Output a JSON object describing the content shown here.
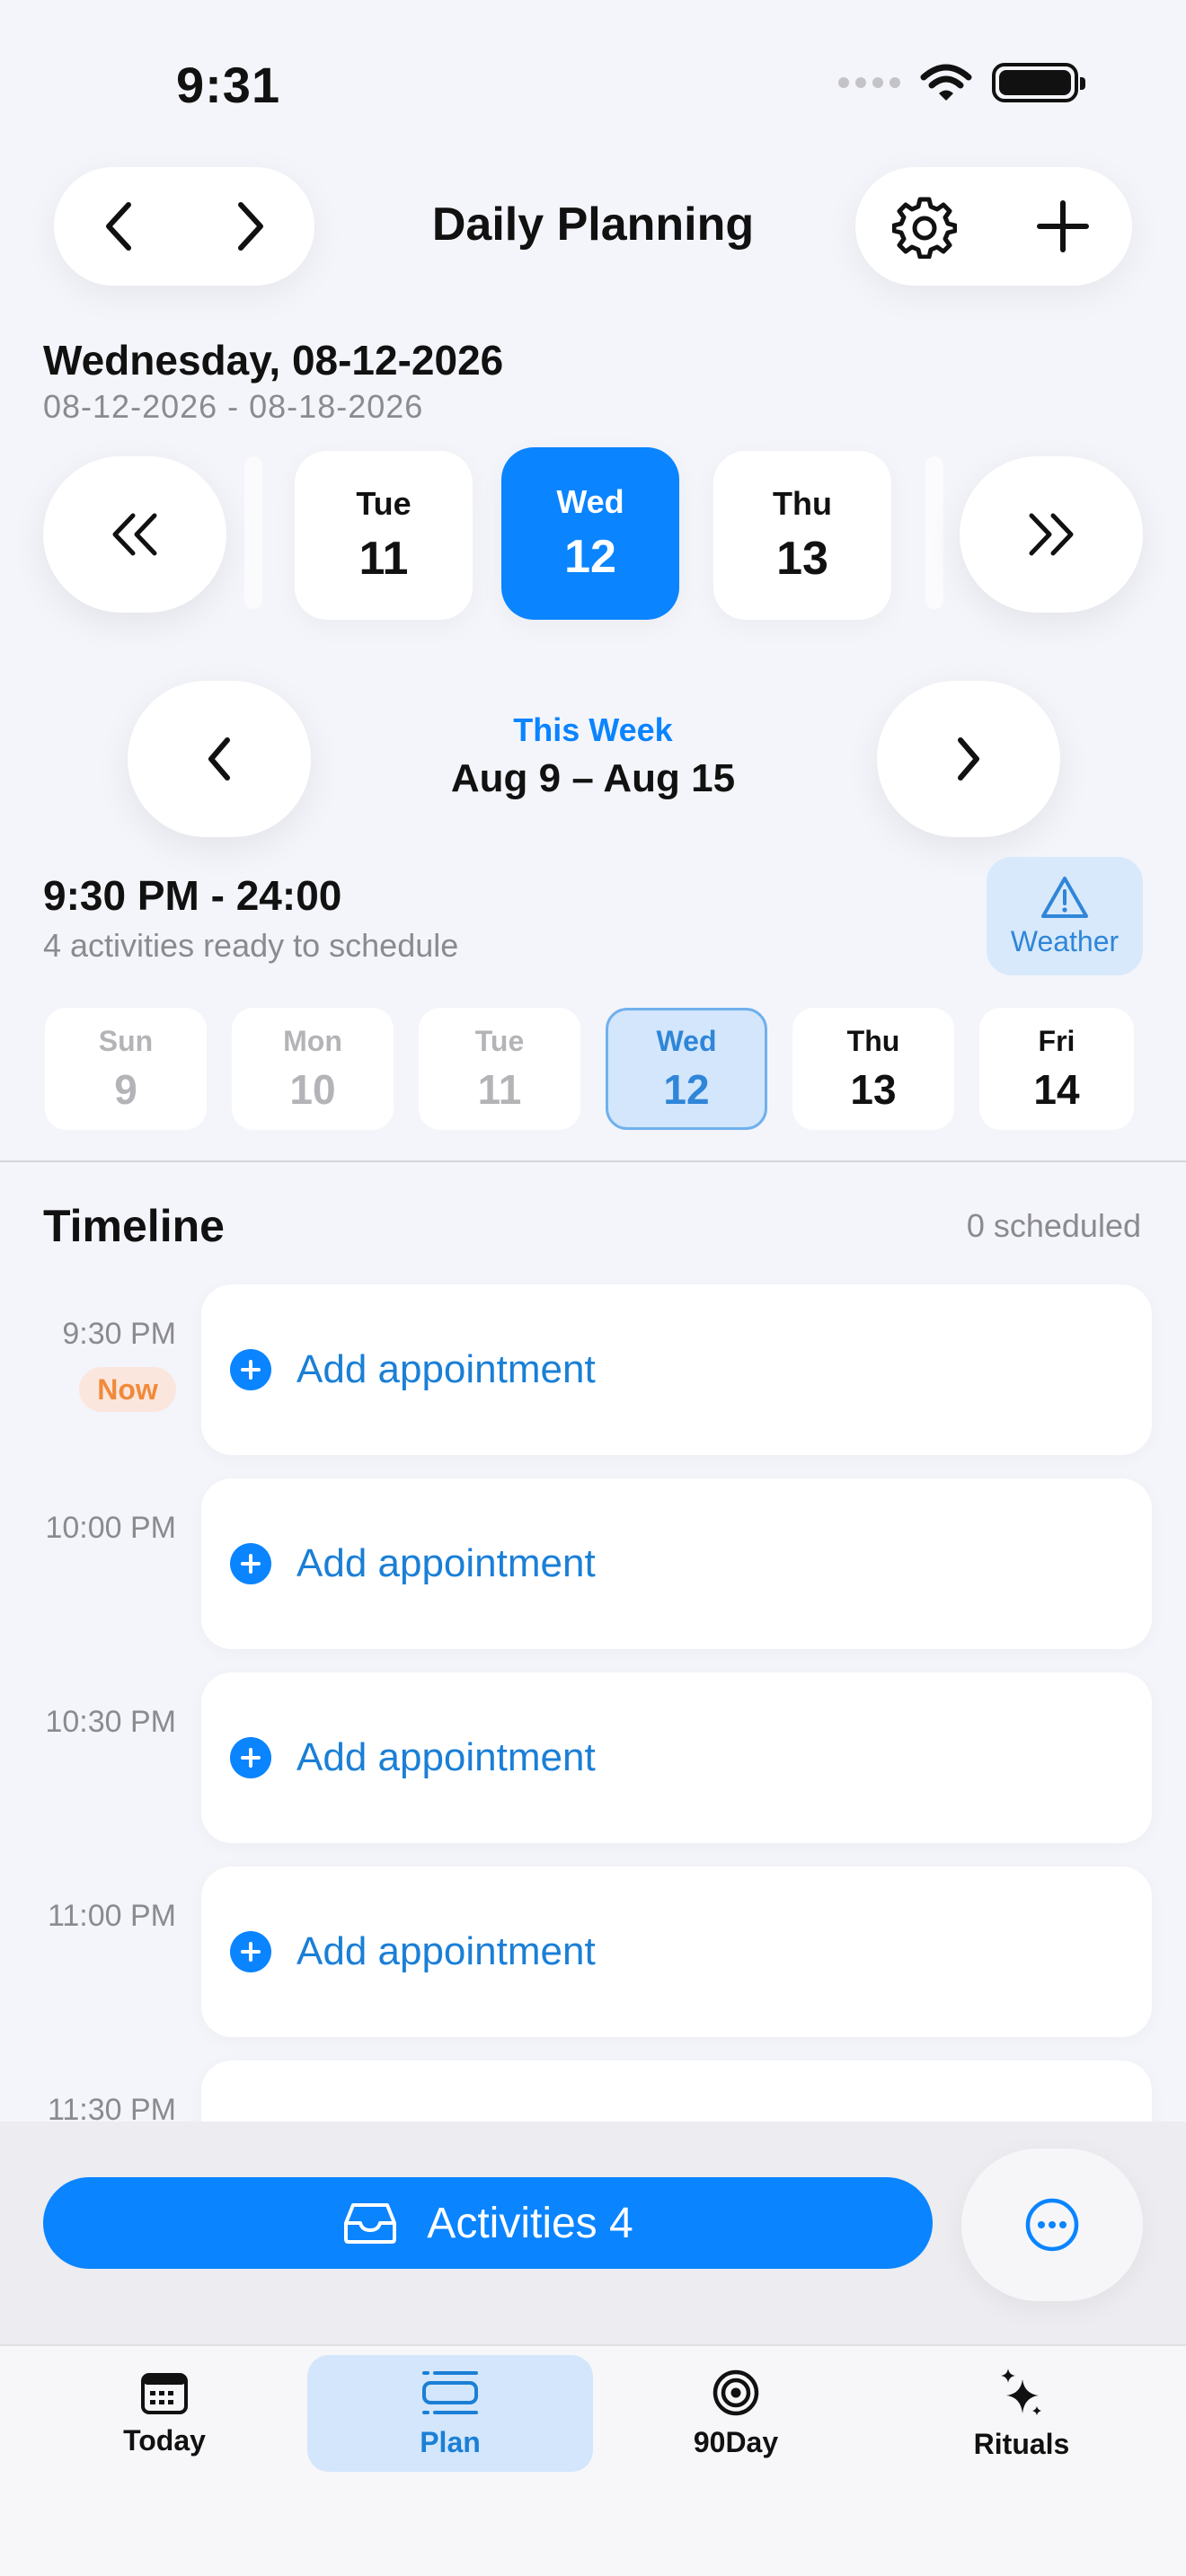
{
  "status_bar": {
    "time": "9:31"
  },
  "header": {
    "title": "Daily Planning"
  },
  "date_header": {
    "title": "Wednesday, 08-12-2026",
    "range": "08-12-2026 - 08-18-2026"
  },
  "day_strip": [
    {
      "name": "Tue",
      "date": "11",
      "selected": false
    },
    {
      "name": "Wed",
      "date": "12",
      "selected": true
    },
    {
      "name": "Thu",
      "date": "13",
      "selected": false
    }
  ],
  "week": {
    "label": "This Week",
    "range": "Aug 9 – Aug 15"
  },
  "slot": {
    "title": "9:30 PM - 24:00",
    "subtitle": "4 activities ready to schedule"
  },
  "weather": {
    "label": "Weather"
  },
  "week_days": [
    {
      "name": "Sun",
      "date": "9",
      "state": "past"
    },
    {
      "name": "Mon",
      "date": "10",
      "state": "past"
    },
    {
      "name": "Tue",
      "date": "11",
      "state": "past"
    },
    {
      "name": "Wed",
      "date": "12",
      "state": "selected"
    },
    {
      "name": "Thu",
      "date": "13",
      "state": "future"
    },
    {
      "name": "Fri",
      "date": "14",
      "state": "future"
    }
  ],
  "timeline": {
    "title": "Timeline",
    "scheduled": "0 scheduled",
    "now_label": "Now",
    "slots": [
      {
        "time": "9:30 PM",
        "action": "Add appointment"
      },
      {
        "time": "10:00 PM",
        "action": "Add appointment"
      },
      {
        "time": "10:30 PM",
        "action": "Add appointment"
      },
      {
        "time": "11:00 PM",
        "action": "Add appointment"
      },
      {
        "time": "11:30 PM",
        "action": ""
      }
    ]
  },
  "activities_button": {
    "label": "Activities 4"
  },
  "tabs": [
    {
      "label": "Today",
      "icon": "calendar-icon",
      "active": false
    },
    {
      "label": "Plan",
      "icon": "plan-list-icon",
      "active": true
    },
    {
      "label": "90Day",
      "icon": "target-icon",
      "active": false
    },
    {
      "label": "Rituals",
      "icon": "sparkles-icon",
      "active": false
    }
  ],
  "colors": {
    "accent": "#0a84ff",
    "accent_light": "#d3e6fb",
    "now": "#f08a3a"
  }
}
